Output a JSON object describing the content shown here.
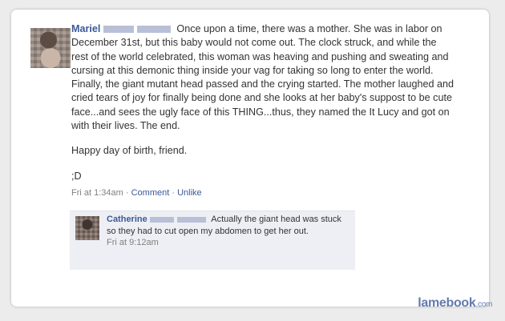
{
  "post": {
    "author": "Mariel",
    "text": "Once upon a time, there was a mother. She was in labor on December 31st, but this baby would not come out. The clock struck, and while the rest of the world celebrated, this woman was heaving and pushing and sweating and cursing at this demonic thing inside your vag for taking so long to enter the world. Finally, the giant mutant head passed and the crying started. The mother laughed and cried tears of joy for finally being done and she looks at her baby's suppost to be cute face...and sees the ugly face of this THING...thus, they named the It Lucy and got on with their lives. The end.",
    "line2": "Happy day of birth, friend.",
    "line3": ";D",
    "time": "Fri at 1:34am",
    "sep": " · ",
    "comment_label": "Comment",
    "unlike_label": "Unlike"
  },
  "reply": {
    "author": "Catherine",
    "text": "Actually the giant head was stuck so they had to cut open my abdomen to get her out.",
    "time": "Fri at 9:12am"
  },
  "watermark": {
    "brand": "lamebook",
    "suffix": ".com"
  }
}
